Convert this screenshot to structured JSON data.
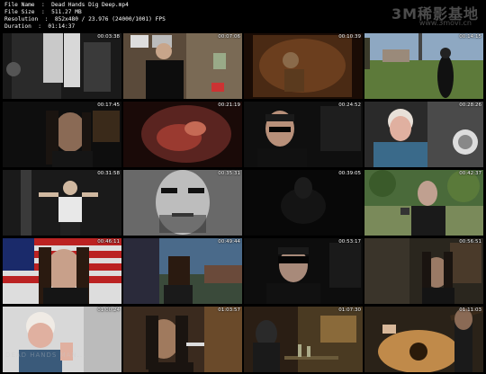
{
  "file_info": {
    "name_line": "File Name  :  Dead Hands Dig Deep.mp4",
    "size_line": "File Size  :  511.27 MB",
    "resolution_line": "Resolution  :  852x480 / 23.976 (24000/1001) FPS",
    "duration_line": "Duration  :  01:14:37"
  },
  "watermark": {
    "brand": "3M稀影基地",
    "url": "www.3movi.cn",
    "bottom": "DEAD HANDS MAN..."
  },
  "thumbnails": [
    {
      "timestamp": "00:03:38",
      "scene": "legs-crowd"
    },
    {
      "timestamp": "00:07:06",
      "scene": "man-room-posters"
    },
    {
      "timestamp": "00:10:39",
      "scene": "sepia-photo"
    },
    {
      "timestamp": "00:14:15",
      "scene": "yard-figure"
    },
    {
      "timestamp": "00:17:45",
      "scene": "long-hair-dark"
    },
    {
      "timestamp": "00:21:19",
      "scene": "red-closeup"
    },
    {
      "timestamp": "00:24:52",
      "scene": "sunglasses-man"
    },
    {
      "timestamp": "00:28:26",
      "scene": "woman-blonde"
    },
    {
      "timestamp": "00:31:58",
      "scene": "man-tanktop"
    },
    {
      "timestamp": "00:35:31",
      "scene": "bw-face"
    },
    {
      "timestamp": "00:39:05",
      "scene": "dark-scene"
    },
    {
      "timestamp": "00:42:37",
      "scene": "man-outdoor-trees"
    },
    {
      "timestamp": "00:46:11",
      "scene": "flag-man"
    },
    {
      "timestamp": "00:49:44",
      "scene": "car-window"
    },
    {
      "timestamp": "00:53:17",
      "scene": "sunglasses-dark"
    },
    {
      "timestamp": "00:56:51",
      "scene": "long-hair-room"
    },
    {
      "timestamp": "01:00:24",
      "scene": "woman-crying"
    },
    {
      "timestamp": "01:03:57",
      "scene": "man-smoking"
    },
    {
      "timestamp": "01:07:30",
      "scene": "bar-scene"
    },
    {
      "timestamp": "01:11:03",
      "scene": "guitar-player"
    }
  ]
}
